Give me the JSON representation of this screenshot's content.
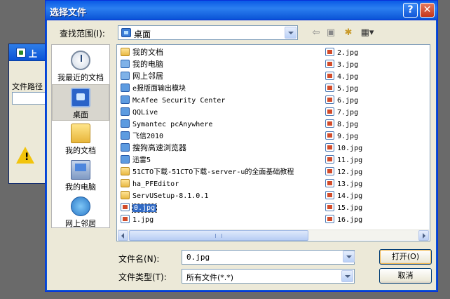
{
  "background_window": {
    "title": "上",
    "label": "文件路径"
  },
  "dialog": {
    "title": "选择文件",
    "help_label": "?",
    "close_label": "✕"
  },
  "lookin": {
    "label": "查找范围(I):",
    "value": "桌面"
  },
  "toolbar": {
    "back_glyph": "⇦",
    "up_glyph": "▣",
    "new_folder_glyph": "✱",
    "views_glyph": "▦▾"
  },
  "places": [
    {
      "label": "我最近的文档",
      "icon": "recent-docs-icon"
    },
    {
      "label": "桌面",
      "icon": "desktop-icon"
    },
    {
      "label": "我的文档",
      "icon": "my-documents-icon"
    },
    {
      "label": "我的电脑",
      "icon": "my-computer-icon"
    },
    {
      "label": "网上邻居",
      "icon": "network-places-icon"
    }
  ],
  "files_col1": [
    {
      "name": "我的文档",
      "icon": "folder"
    },
    {
      "name": "我的电脑",
      "icon": "sys"
    },
    {
      "name": "网上邻居",
      "icon": "sys"
    },
    {
      "name": "e报版面输出模块",
      "icon": "app"
    },
    {
      "name": "McAfee Security Center",
      "icon": "app"
    },
    {
      "name": "QQLive",
      "icon": "app"
    },
    {
      "name": "Symantec pcAnywhere",
      "icon": "app"
    },
    {
      "name": "飞信2010",
      "icon": "app"
    },
    {
      "name": "搜狗高速浏览器",
      "icon": "app"
    },
    {
      "name": "迅雷5",
      "icon": "app"
    },
    {
      "name": "51CTO下载-51CTO下载-server-u的全面基础教程",
      "icon": "folder"
    },
    {
      "name": "ha_PFEditor",
      "icon": "folder"
    },
    {
      "name": "ServUSetup-8.1.0.1",
      "icon": "folder"
    },
    {
      "name": "0.jpg",
      "icon": "img",
      "selected": true
    },
    {
      "name": "1.jpg",
      "icon": "img"
    }
  ],
  "files_col2": [
    {
      "name": "2.jpg"
    },
    {
      "name": "3.jpg"
    },
    {
      "name": "4.jpg"
    },
    {
      "name": "5.jpg"
    },
    {
      "name": "6.jpg"
    },
    {
      "name": "7.jpg"
    },
    {
      "name": "8.jpg"
    },
    {
      "name": "9.jpg"
    },
    {
      "name": "10.jpg"
    },
    {
      "name": "11.jpg"
    },
    {
      "name": "12.jpg"
    },
    {
      "name": "13.jpg"
    },
    {
      "name": "14.jpg"
    },
    {
      "name": "15.jpg"
    },
    {
      "name": "16.jpg"
    }
  ],
  "filename": {
    "label": "文件名(N):",
    "value": "0.jpg"
  },
  "filetype": {
    "label": "文件类型(T):",
    "value": "所有文件(*.*)"
  },
  "buttons": {
    "open": "打开(O)",
    "cancel": "取消"
  },
  "colors": {
    "titlebar": "#0a53d6",
    "selection": "#316ac5",
    "dialog_bg": "#ece9d8"
  }
}
